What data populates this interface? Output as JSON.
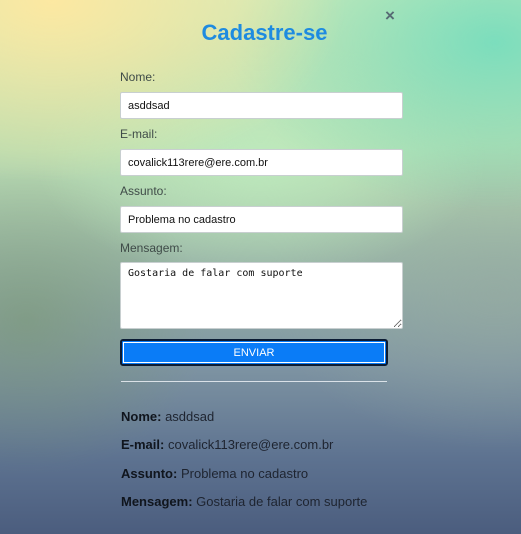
{
  "form": {
    "title": "Cadastre-se",
    "close_icon": "×",
    "fields": {
      "nome": {
        "label": "Nome:",
        "value": "asddsad"
      },
      "email": {
        "label": "E-mail:",
        "value": "covalick113rere@ere.com.br"
      },
      "assunto": {
        "label": "Assunto:",
        "value": "Problema no cadastro"
      },
      "mensagem": {
        "label": "Mensagem:",
        "value": "Gostaria de falar com suporte"
      }
    },
    "submit_label": "ENVIAR"
  },
  "summary": {
    "nome": {
      "label": "Nome:",
      "value": "asddsad"
    },
    "email": {
      "label": "E-mail:",
      "value": "covalick113rere@ere.com.br"
    },
    "assunto": {
      "label": "Assunto:",
      "value": "Problema no cadastro"
    },
    "mensagem": {
      "label": "Mensagem:",
      "value": "Gostaria de falar com suporte"
    }
  },
  "colors": {
    "title": "#1e8be0",
    "submit_bg": "#0a7cf7"
  }
}
